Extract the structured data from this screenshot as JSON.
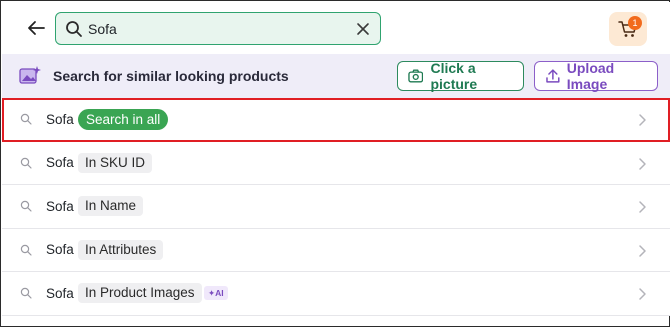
{
  "header": {
    "search": {
      "value": "Sofa",
      "placeholder": ""
    },
    "cart": {
      "badge_count": "1"
    }
  },
  "similar": {
    "text": "Search for similar looking products",
    "click_picture_label": "Click a picture",
    "upload_image_label": "Upload Image"
  },
  "suggestions": [
    {
      "term": "Sofa",
      "tag": "Search in all"
    },
    {
      "term": "Sofa",
      "tag": "In SKU ID"
    },
    {
      "term": "Sofa",
      "tag": "In Name"
    },
    {
      "term": "Sofa",
      "tag": "In Attributes"
    },
    {
      "term": "Sofa",
      "tag": "In Product Images",
      "badge": "✦AI"
    }
  ],
  "colors": {
    "search_border": "#2fa36f",
    "search_bg": "#e8f5ee",
    "accent_green": "#3aa553",
    "accent_purple": "#7a4bbf",
    "cart_bg": "#fde9d4",
    "cart_badge": "#f26b1d",
    "highlight_border": "#e01e24"
  }
}
